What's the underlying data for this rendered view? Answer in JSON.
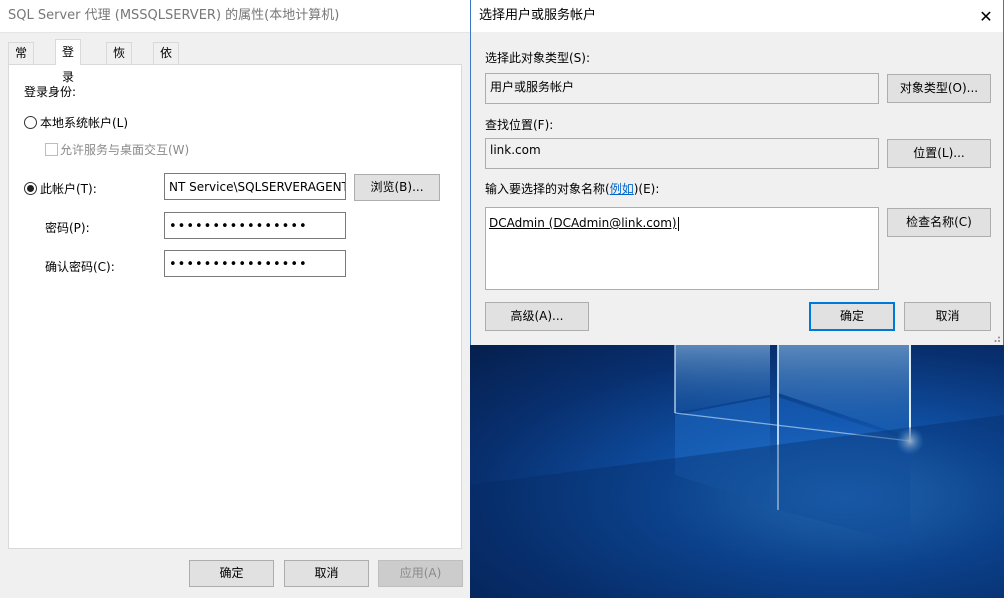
{
  "left_dialog": {
    "title": "SQL Server 代理 (MSSQLSERVER) 的属性(本地计算机)",
    "tabs": [
      "常规",
      "登录",
      "恢复",
      "依存关系"
    ],
    "active_tab": "登录",
    "login_as_label": "登录身份:",
    "local_system_label": "本地系统帐户(L)",
    "allow_desktop_label": "允许服务与桌面交互(W)",
    "this_account_label": "此帐户(T):",
    "account_value": "NT Service\\SQLSERVERAGENT",
    "browse_button": "浏览(B)...",
    "password_label": "密码(P):",
    "password_value": "••••••••••••••••",
    "confirm_password_label": "确认密码(C):",
    "confirm_password_value": "••••••••••••••••",
    "ok_button": "确定",
    "cancel_button": "取消",
    "apply_button": "应用(A)"
  },
  "right_dialog": {
    "title": "选择用户或服务帐户",
    "object_type_label": "选择此对象类型(S):",
    "object_type_value": "用户或服务帐户",
    "object_types_button": "对象类型(O)...",
    "location_label": "查找位置(F):",
    "location_value": "link.com",
    "locations_button": "位置(L)...",
    "enter_names_label_prefix": "输入要选择的对象名称(",
    "examples_link": "例如",
    "enter_names_label_suffix": ")(E):",
    "names_value": "DCAdmin (DCAdmin@link.com)",
    "check_names_button": "检查名称(C)",
    "advanced_button": "高级(A)...",
    "ok_button": "确定",
    "cancel_button": "取消"
  },
  "colors": {
    "accent": "#0078d7",
    "link": "#0066cc",
    "dialog_bg": "#f0f0f0",
    "desktop_blue": "#0f4fa3"
  }
}
